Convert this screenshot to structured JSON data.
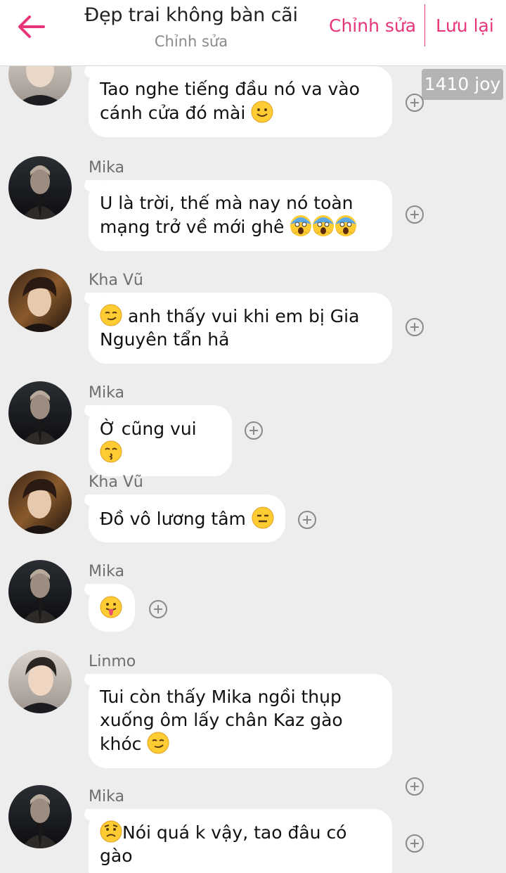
{
  "header": {
    "title": "Đẹp trai không bàn cãi",
    "subtitle": "Chỉnh sửa",
    "edit_label": "Chỉnh sửa",
    "save_label": "Lưu lại",
    "accent": "#e8357a"
  },
  "joy_badge": "1410 joy",
  "icons": [
    "back-arrow-icon",
    "plus-circle-icon",
    "smile-emoji",
    "scream-emoji",
    "smirk-emoji",
    "kiss-emoji",
    "expressionless-emoji",
    "tongue-emoji",
    "worried-emoji"
  ],
  "messages": [
    {
      "sender": "",
      "lines": [
        "Tao nghe tiếng đầu nó va vào",
        "cánh cửa đó mài"
      ],
      "emojis": [
        "smile"
      ]
    },
    {
      "sender": "Mika",
      "lines": [
        "U là trời, thế mà nay nó toàn",
        "mạng trở về mới ghê"
      ],
      "emojis": [
        "scream",
        "scream",
        "scream"
      ]
    },
    {
      "sender": "Kha Vũ",
      "lines": [
        "anh thấy vui khi em bị Gia",
        "Nguyên tẩn hả"
      ],
      "emojis": [
        "smirk"
      ]
    },
    {
      "sender": "Mika",
      "lines": [
        "Ờ cũng vui"
      ],
      "emojis": [
        "kiss"
      ]
    },
    {
      "sender": "Kha Vũ",
      "lines": [
        "Đồ vô lương tâm"
      ],
      "emojis": [
        "expressionless"
      ]
    },
    {
      "sender": "Mika",
      "lines": [],
      "emojis": [
        "tongue"
      ]
    },
    {
      "sender": "Linmo",
      "lines": [
        "Tui còn thấy Mika ngồi thụp",
        "xuống ôm lấy chân Kaz gào",
        "khóc"
      ],
      "emojis": [
        "smirk"
      ]
    },
    {
      "sender": "Mika",
      "lines": [
        "Nói quá k vậy, tao đâu có",
        "gào"
      ],
      "emojis": [
        "worried"
      ]
    }
  ]
}
